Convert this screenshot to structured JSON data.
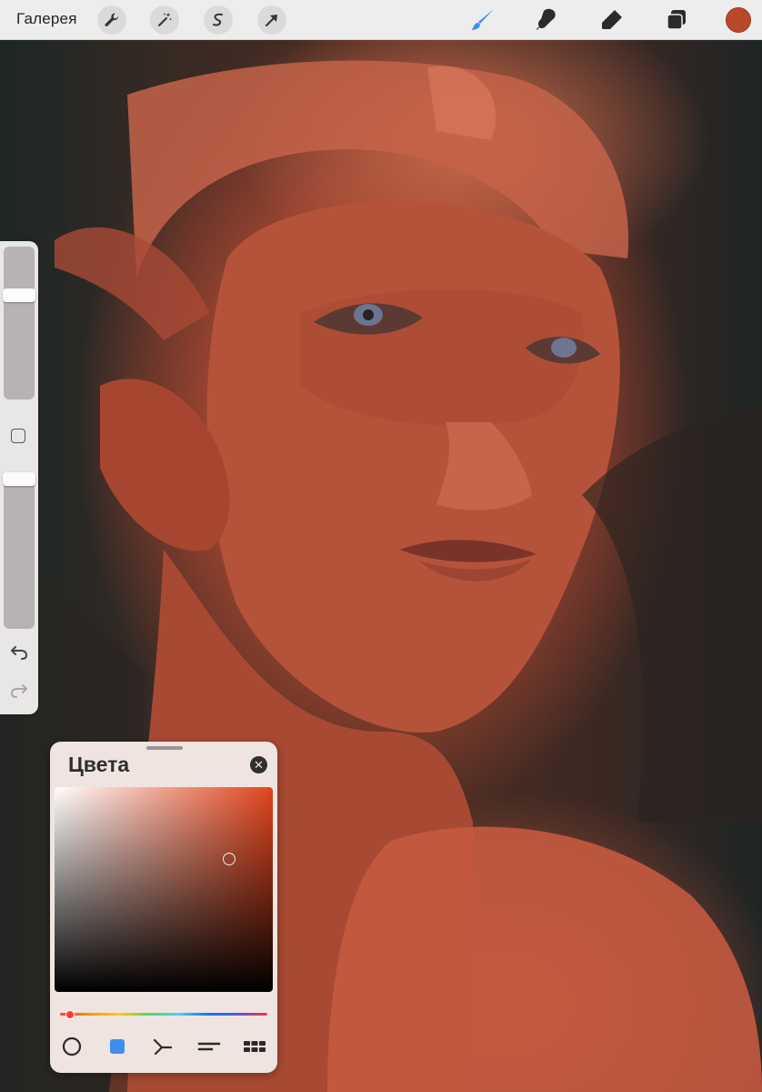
{
  "toolbar": {
    "gallery_label": "Галерея",
    "left_tools": [
      "wrench-icon",
      "magic-wand-icon",
      "selection-icon",
      "move-arrow-icon"
    ],
    "right_tools": [
      "brush-icon",
      "smudge-icon",
      "eraser-icon",
      "layers-icon"
    ],
    "active_tool": "brush-icon",
    "active_color": "#b8482a",
    "accent_color": "#3d8ef0"
  },
  "sidebar": {
    "brush_size_level": 0.7,
    "opacity_level": 1.0,
    "icons": [
      "modify-square-icon",
      "undo-icon",
      "redo-icon"
    ]
  },
  "color_panel": {
    "title": "Цвета",
    "hue_color": "#e1441c",
    "saturation": 0.8,
    "brightness": 0.65,
    "hue_position": 0.05,
    "modes": [
      "disc-mode-icon",
      "classic-mode-icon",
      "harmony-mode-icon",
      "value-mode-icon",
      "palettes-mode-icon"
    ],
    "active_mode": "classic-mode-icon"
  }
}
